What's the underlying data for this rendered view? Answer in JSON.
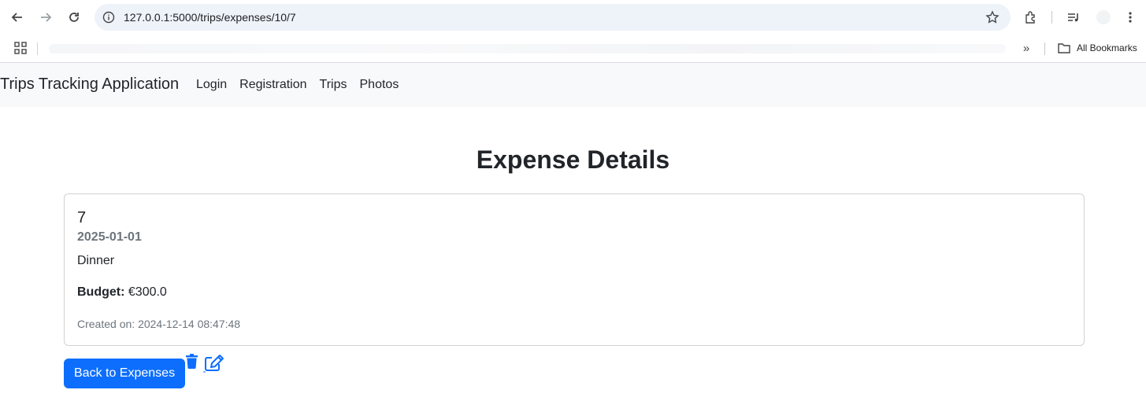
{
  "browser": {
    "url": "127.0.0.1:5000/trips/expenses/10/7",
    "bookmarks_all_label": "All Bookmarks"
  },
  "navbar": {
    "brand": "Trips Tracking Application",
    "links": [
      "Login",
      "Registration",
      "Trips",
      "Photos"
    ]
  },
  "main": {
    "title": "Expense Details",
    "expense": {
      "id": "7",
      "date": "2025-01-01",
      "description": "Dinner",
      "budget_label": "Budget:",
      "budget_value": "€300.0",
      "created_label": "Created on:",
      "created_value": "2024-12-14 08:47:48"
    },
    "back_button": "Back to Expenses",
    "icons": {
      "delete": "trash-icon",
      "edit": "edit-icon"
    }
  },
  "colors": {
    "primary": "#0d6efd",
    "navbar_bg": "#f8f9fa",
    "muted": "#6c757d",
    "text": "#212529"
  }
}
